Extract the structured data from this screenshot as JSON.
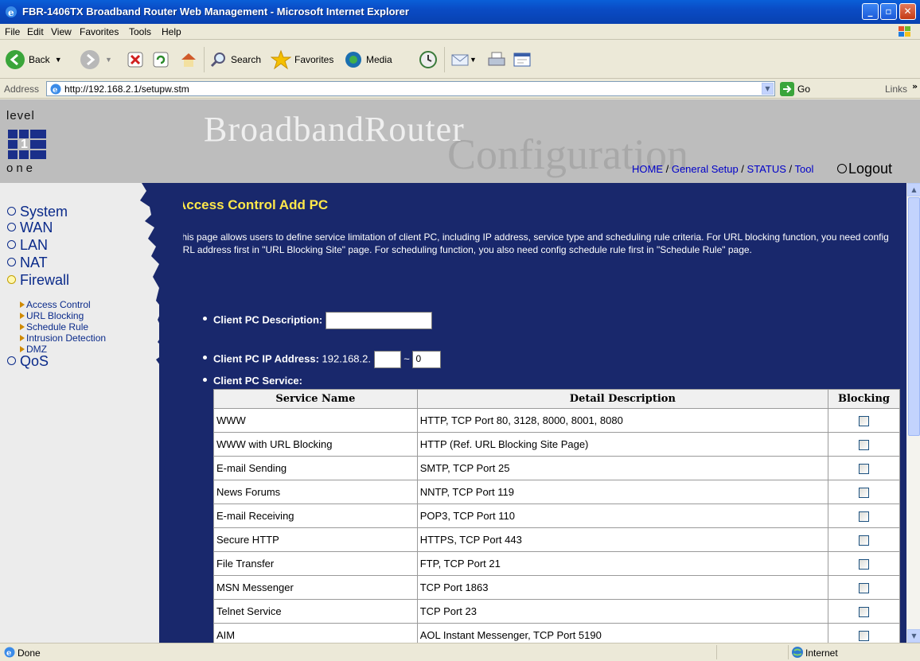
{
  "window": {
    "title": "FBR-1406TX Broadband Router Web Management - Microsoft Internet Explorer",
    "controls": [
      "minimize",
      "maximize",
      "close"
    ]
  },
  "menubar": {
    "items": [
      "File",
      "Edit",
      "View",
      "Favorites",
      "Tools",
      "Help"
    ]
  },
  "toolbar": {
    "back": "Back",
    "search": "Search",
    "favorites": "Favorites",
    "media": "Media"
  },
  "addressbar": {
    "label": "Address",
    "url": "http://192.168.2.1/setupw.stm",
    "go": "Go",
    "links": "Links"
  },
  "header": {
    "logo_top": "level",
    "logo_bottom": "one",
    "brand_main": "BroadbandRouter",
    "brand_sub": "Configuration",
    "nav": {
      "home": "HOME",
      "general": "General Setup",
      "status": "STATUS",
      "tool": "Tool"
    },
    "logout": "Logout"
  },
  "sidebar": {
    "items": [
      {
        "label": "System"
      },
      {
        "label": "WAN"
      },
      {
        "label": "LAN"
      },
      {
        "label": "NAT"
      },
      {
        "label": "Firewall"
      },
      {
        "label": "QoS"
      }
    ],
    "firewall_sub": [
      "Access Control",
      "URL Blocking",
      "Schedule Rule",
      "Intrusion Detection",
      "DMZ"
    ]
  },
  "content": {
    "title": "Access Control Add PC",
    "description": "This page allows users to define service limitation of client PC, including IP address, service type and scheduling rule criteria. For URL blocking function, you need config URL address first in \"URL Blocking Site\" page. For scheduling function, you also need config schedule rule first in \"Schedule Rule\" page.",
    "desc_label": "Client PC Description:",
    "desc_value": "",
    "ip_label": "Client PC IP Address:",
    "ip_prefix": "192.168.2.",
    "ip_start": "",
    "ip_sep": "~",
    "ip_end": "0",
    "service_label": "Client PC Service:",
    "table": {
      "headers": [
        "Service Name",
        "Detail Description",
        "Blocking"
      ],
      "rows": [
        {
          "name": "WWW",
          "desc": "HTTP, TCP Port 80, 3128, 8000, 8001, 8080",
          "blocked": false
        },
        {
          "name": "WWW with URL Blocking",
          "desc": "HTTP (Ref. URL Blocking Site Page)",
          "blocked": false
        },
        {
          "name": "E-mail Sending",
          "desc": "SMTP, TCP Port 25",
          "blocked": false
        },
        {
          "name": "News Forums",
          "desc": "NNTP, TCP Port 119",
          "blocked": false
        },
        {
          "name": "E-mail Receiving",
          "desc": "POP3, TCP Port 110",
          "blocked": false
        },
        {
          "name": "Secure HTTP",
          "desc": "HTTPS, TCP Port 443",
          "blocked": false
        },
        {
          "name": "File Transfer",
          "desc": "FTP, TCP Port 21",
          "blocked": false
        },
        {
          "name": "MSN Messenger",
          "desc": "TCP Port 1863",
          "blocked": false
        },
        {
          "name": "Telnet Service",
          "desc": "TCP Port 23",
          "blocked": false
        },
        {
          "name": "AIM",
          "desc": "AOL Instant Messenger, TCP Port 5190",
          "blocked": false
        }
      ]
    }
  },
  "statusbar": {
    "status": "Done",
    "zone": "Internet"
  }
}
